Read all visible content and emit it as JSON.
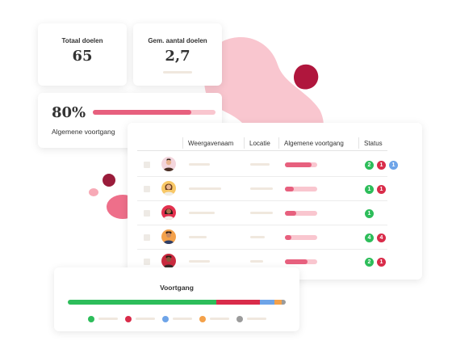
{
  "stats": {
    "total_label": "Totaal doelen",
    "total_value": "65",
    "avg_label": "Gem. aantal doelen",
    "avg_value": "2,7"
  },
  "overall_progress": {
    "value_text": "80%",
    "label": "Algemene voortgang",
    "percent": 80
  },
  "table": {
    "columns": [
      "Weergavenaam",
      "Locatie",
      "Algemene voortgang",
      "Status"
    ],
    "rows": [
      {
        "progress": 0.82,
        "badges": [
          {
            "text": "2",
            "color": "#2dbd5a"
          },
          {
            "text": "1",
            "color": "#d92c4a"
          },
          {
            "text": "1",
            "color": "#6ea4e8"
          }
        ]
      },
      {
        "progress": 0.28,
        "badges": [
          {
            "text": "1",
            "color": "#2dbd5a"
          },
          {
            "text": "1",
            "color": "#d92c4a"
          }
        ]
      },
      {
        "progress": 0.35,
        "badges": [
          {
            "text": "1",
            "color": "#2dbd5a"
          }
        ]
      },
      {
        "progress": 0.2,
        "badges": [
          {
            "text": "4",
            "color": "#2dbd5a"
          },
          {
            "text": "4",
            "color": "#d92c4a"
          }
        ]
      },
      {
        "progress": 0.7,
        "badges": [
          {
            "text": "2",
            "color": "#2dbd5a"
          },
          {
            "text": "1",
            "color": "#d92c4a"
          }
        ]
      }
    ]
  },
  "voortgang": {
    "title": "Voortgang",
    "segments": [
      {
        "color": "#2dbd5a",
        "share": 0.68
      },
      {
        "color": "#d92c4a",
        "share": 0.2
      },
      {
        "color": "#6ea4e8",
        "share": 0.07
      },
      {
        "color": "#f4a14a",
        "share": 0.03
      },
      {
        "color": "#9b9b9b",
        "share": 0.02
      }
    ],
    "legend_colors": [
      "#2dbd5a",
      "#d92c4a",
      "#6ea4e8",
      "#f4a14a",
      "#9b9b9b"
    ]
  }
}
